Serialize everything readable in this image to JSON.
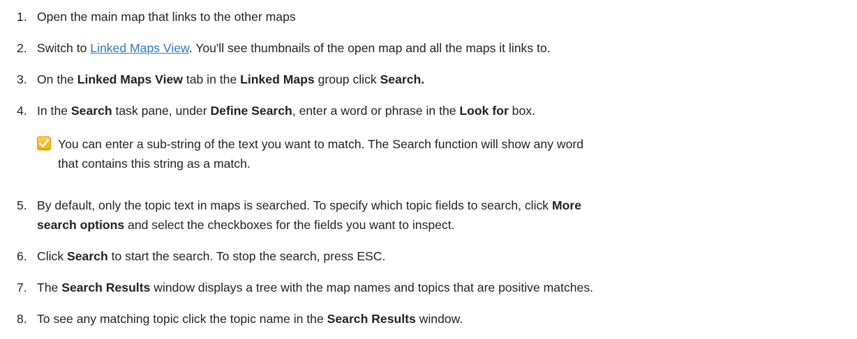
{
  "steps": [
    {
      "num": "1.",
      "parts": [
        {
          "t": "Open the main map that links to the other maps"
        }
      ]
    },
    {
      "num": "2.",
      "parts": [
        {
          "t": "Switch to "
        },
        {
          "t": "Linked Maps View",
          "link": true
        },
        {
          "t": ". You'll see thumbnails of the open map and all the maps it links to."
        }
      ]
    },
    {
      "num": "3.",
      "parts": [
        {
          "t": "On the "
        },
        {
          "t": "Linked Maps View",
          "b": true
        },
        {
          "t": " tab in the "
        },
        {
          "t": "Linked Maps",
          "b": true
        },
        {
          "t": " group click "
        },
        {
          "t": "Search.",
          "b": true
        }
      ]
    },
    {
      "num": "4.",
      "parts": [
        {
          "t": "In the "
        },
        {
          "t": "Search",
          "b": true
        },
        {
          "t": " task pane, under "
        },
        {
          "t": "Define Search",
          "b": true
        },
        {
          "t": ", enter a word or phrase in the "
        },
        {
          "t": "Look for",
          "b": true
        },
        {
          "t": " box."
        }
      ]
    },
    {
      "num": "5.",
      "parts": [
        {
          "t": "By default, only the topic text in maps is searched. To specify which topic fields to search, click "
        },
        {
          "t": "More",
          "b": true
        }
      ],
      "parts2": [
        {
          "t": "search options",
          "b": true
        },
        {
          "t": " and select the checkboxes for the fields you want to inspect."
        }
      ]
    },
    {
      "num": "6.",
      "parts": [
        {
          "t": "Click "
        },
        {
          "t": "Search",
          "b": true
        },
        {
          "t": " to start the search. To stop the search, press ESC."
        }
      ]
    },
    {
      "num": "7.",
      "parts": [
        {
          "t": "The "
        },
        {
          "t": "Search Results",
          "b": true
        },
        {
          "t": " window displays a tree with the map names and topics that are positive matches."
        }
      ]
    },
    {
      "num": "8.",
      "parts": [
        {
          "t": "To see any matching topic click the topic name in the "
        },
        {
          "t": "Search Results",
          "b": true
        },
        {
          "t": " window."
        }
      ]
    }
  ],
  "tip": {
    "icon": "checkmark-icon",
    "line1": "You can enter a sub-string of the text you want to match. The Search function will show any word",
    "line2": "that contains this string as a match.",
    "color": "#f5b81e"
  }
}
